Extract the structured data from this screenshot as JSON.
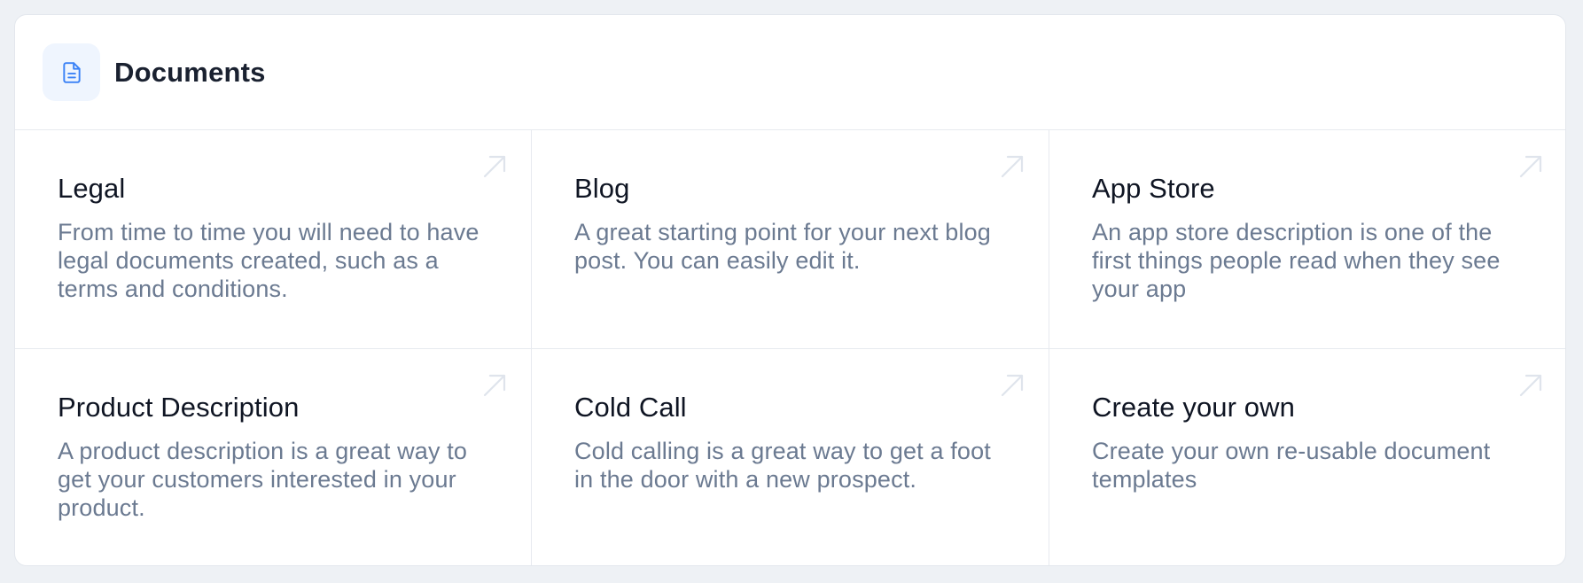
{
  "header": {
    "icon": "document-icon",
    "title": "Documents"
  },
  "tiles": [
    {
      "title": "Legal",
      "description": "From time to time you will need to have legal documents created, such as a terms and conditions.",
      "icon": "arrow-up-right-icon"
    },
    {
      "title": "Blog",
      "description": "A great starting point for your next blog post. You can easily edit it.",
      "icon": "arrow-up-right-icon"
    },
    {
      "title": "App Store",
      "description": "An app store description is one of the first things people read when they see your app",
      "icon": "arrow-up-right-icon"
    },
    {
      "title": "Product Description",
      "description": "A product description is a great way to get your customers interested in your product.",
      "icon": "arrow-up-right-icon"
    },
    {
      "title": "Cold Call",
      "description": "Cold calling is a great way to get a foot in the door with a new prospect.",
      "icon": "arrow-up-right-icon"
    },
    {
      "title": "Create your own",
      "description": "Create your own re-usable document templates",
      "icon": "arrow-up-right-icon"
    }
  ],
  "colors": {
    "accent": "#3b82f6",
    "icon_bg": "#eff5fe",
    "arrow": "#dfe4ec",
    "description": "#6b7a91"
  }
}
